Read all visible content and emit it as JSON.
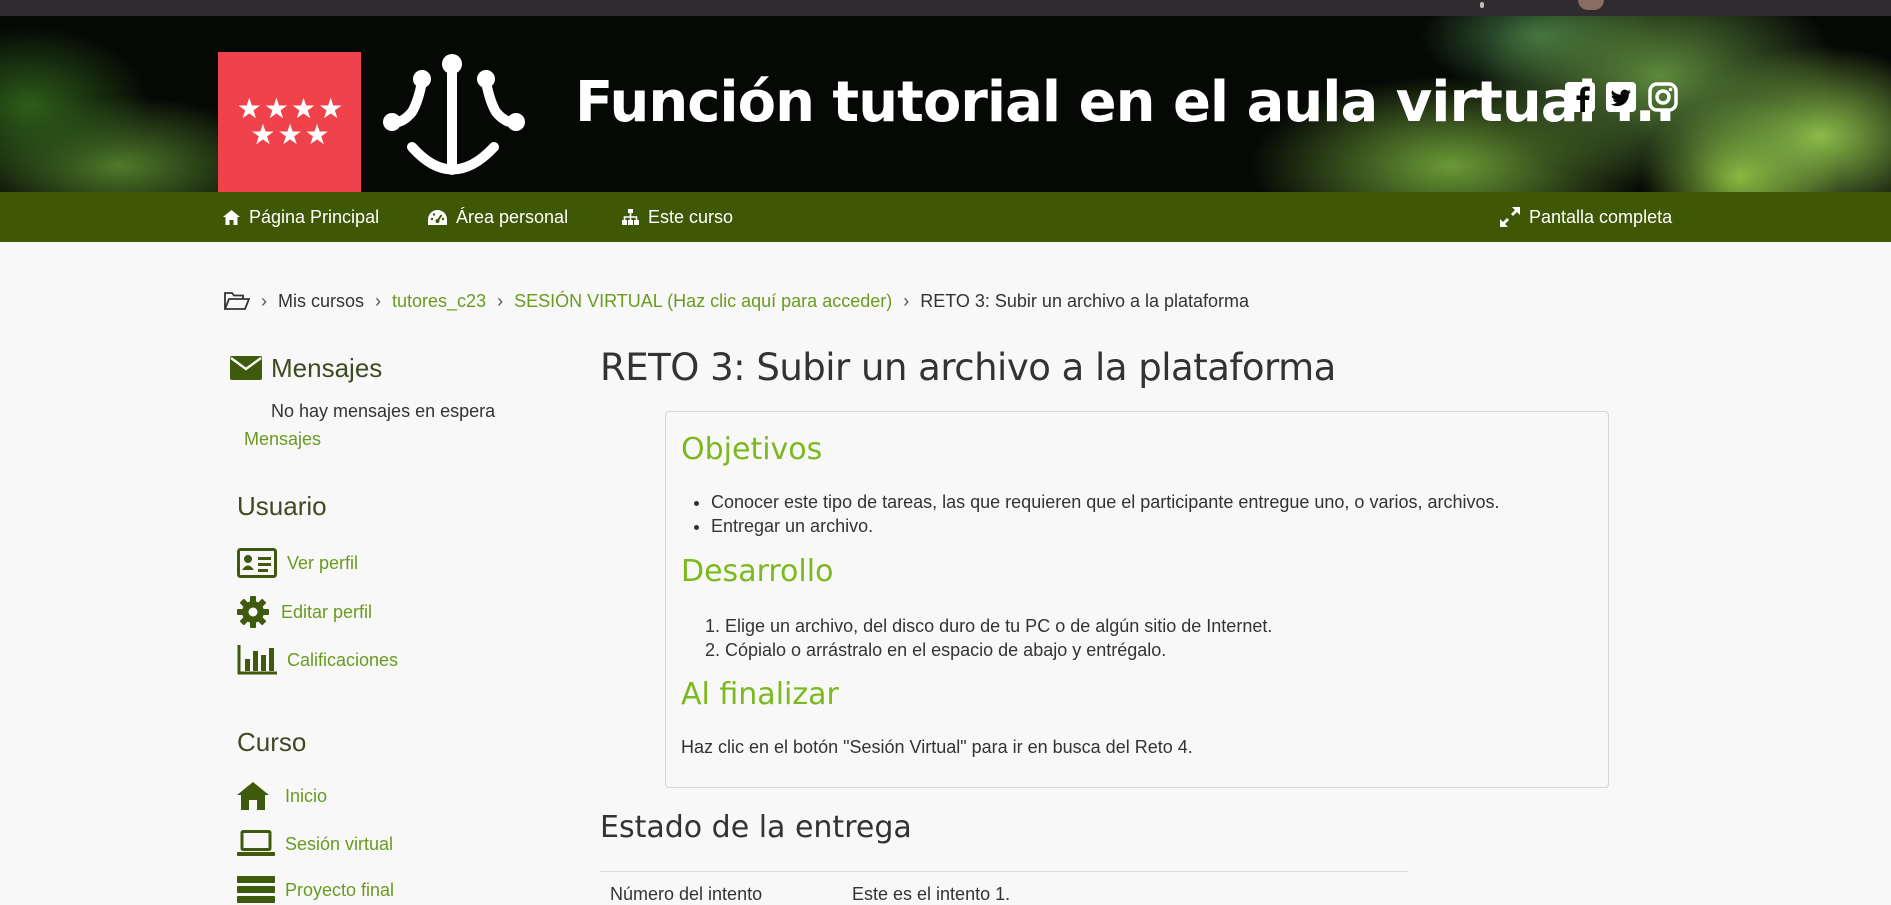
{
  "header": {
    "site_title": "Función tutorial en el aula virtual ...",
    "social": [
      "facebook-icon",
      "twitter-icon",
      "instagram-icon"
    ],
    "flag_stars": "★★★★\n★★★"
  },
  "nav": {
    "home": "Página Principal",
    "dashboard": "Área personal",
    "course": "Este curso",
    "fullscreen": "Pantalla completa"
  },
  "breadcrumb": {
    "items": [
      "Mis cursos",
      "tutores_c23",
      "SESIÓN VIRTUAL (Haz clic aquí para acceder)",
      "RETO 3: Subir un archivo a la plataforma"
    ],
    "separator": "›"
  },
  "sidebar": {
    "messages": {
      "title": "Mensajes",
      "empty": "No hay mensajes en espera",
      "link": "Mensajes"
    },
    "user": {
      "title": "Usuario",
      "items": [
        "Ver perfil",
        "Editar perfil",
        "Calificaciones"
      ]
    },
    "course": {
      "title": "Curso",
      "items": [
        "Inicio",
        "Sesión virtual",
        "Proyecto final"
      ]
    }
  },
  "main": {
    "title": "RETO 3: Subir un archivo a la plataforma",
    "objectives": {
      "heading": "Objetivos",
      "items": [
        "Conocer este tipo de tareas, las que requieren que el participante entregue uno, o varios, archivos.",
        "Entregar un archivo."
      ]
    },
    "development": {
      "heading": "Desarrollo",
      "steps": [
        "Elige un archivo, del disco duro de tu PC o de algún sitio de Internet.",
        "Cópialo o arrástralo en el espacio de abajo y entrégalo."
      ]
    },
    "finish": {
      "heading": "Al finalizar",
      "text": "Haz clic en el botón \"Sesión Virtual\" para ir en busca del Reto 4."
    },
    "submission": {
      "title": "Estado de la entrega",
      "rows": [
        {
          "label": "Número del intento",
          "value": "Este es el intento 1."
        }
      ]
    }
  },
  "colors": {
    "nav_bg": "#3e5806",
    "link": "#6a9a1e",
    "heading_green": "#7cb91e",
    "flag_red": "#f0424b"
  }
}
